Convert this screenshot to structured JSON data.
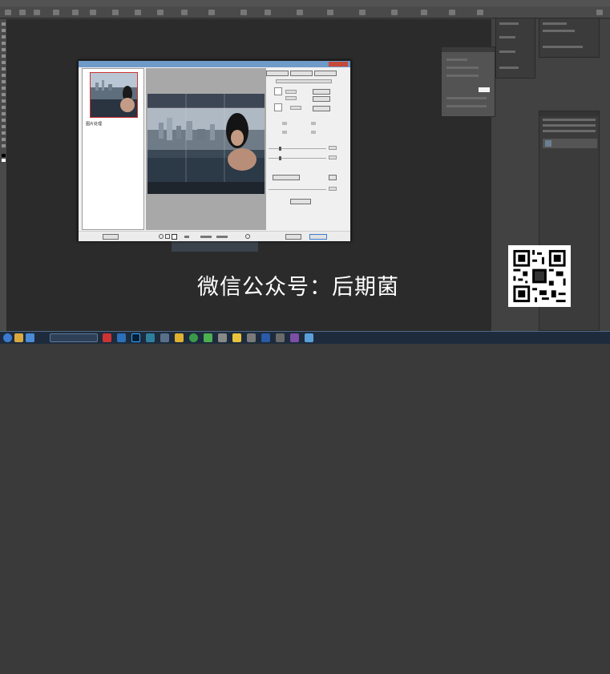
{
  "watermark": {
    "text": "微信公众号：后期菌"
  },
  "dialog": {
    "thumbnail_label": "图片处理"
  },
  "colors": {
    "workspace": "#2b2b2b",
    "panel": "#3b3b3b",
    "dialog_bg": "#f0f0f0",
    "titlebar": "#6f9bc9",
    "taskbar": "#1e2b3c",
    "watermark": "#ffffff"
  },
  "taskbar_icons": [
    "start-orb",
    "explorer",
    "browser",
    "app-red",
    "app-word",
    "ps-blue",
    "folder",
    "chrome",
    "app-green",
    "app-star",
    "media",
    "doc-word",
    "app-gray",
    "app-purple",
    "app-lightblue"
  ]
}
